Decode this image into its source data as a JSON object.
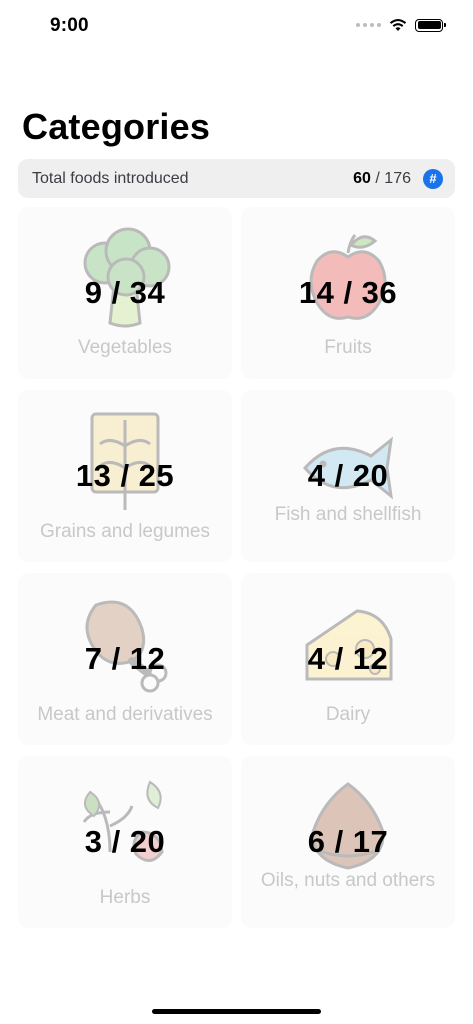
{
  "status_bar": {
    "time": "9:00"
  },
  "header": {
    "title": "Categories"
  },
  "summary": {
    "label": "Total foods introduced",
    "introduced": "60",
    "total": "176",
    "button_icon": "#",
    "button_color": "#1a73e8"
  },
  "categories": [
    {
      "name": "Vegetables",
      "count": "9 / 34",
      "icon": "broccoli-icon"
    },
    {
      "name": "Fruits",
      "count": "14 / 36",
      "icon": "apple-icon"
    },
    {
      "name": "Grains and legumes",
      "count": "13 / 25",
      "icon": "wheat-icon"
    },
    {
      "name": "Fish and shellfish",
      "count": "4 / 20",
      "icon": "fish-icon"
    },
    {
      "name": "Meat and derivatives",
      "count": "7 / 12",
      "icon": "drumstick-icon"
    },
    {
      "name": "Dairy",
      "count": "4 / 12",
      "icon": "cheese-icon"
    },
    {
      "name": "Herbs",
      "count": "3 / 20",
      "icon": "herbs-icon"
    },
    {
      "name": "Oils, nuts and others",
      "count": "6 / 17",
      "icon": "chestnut-icon"
    }
  ]
}
